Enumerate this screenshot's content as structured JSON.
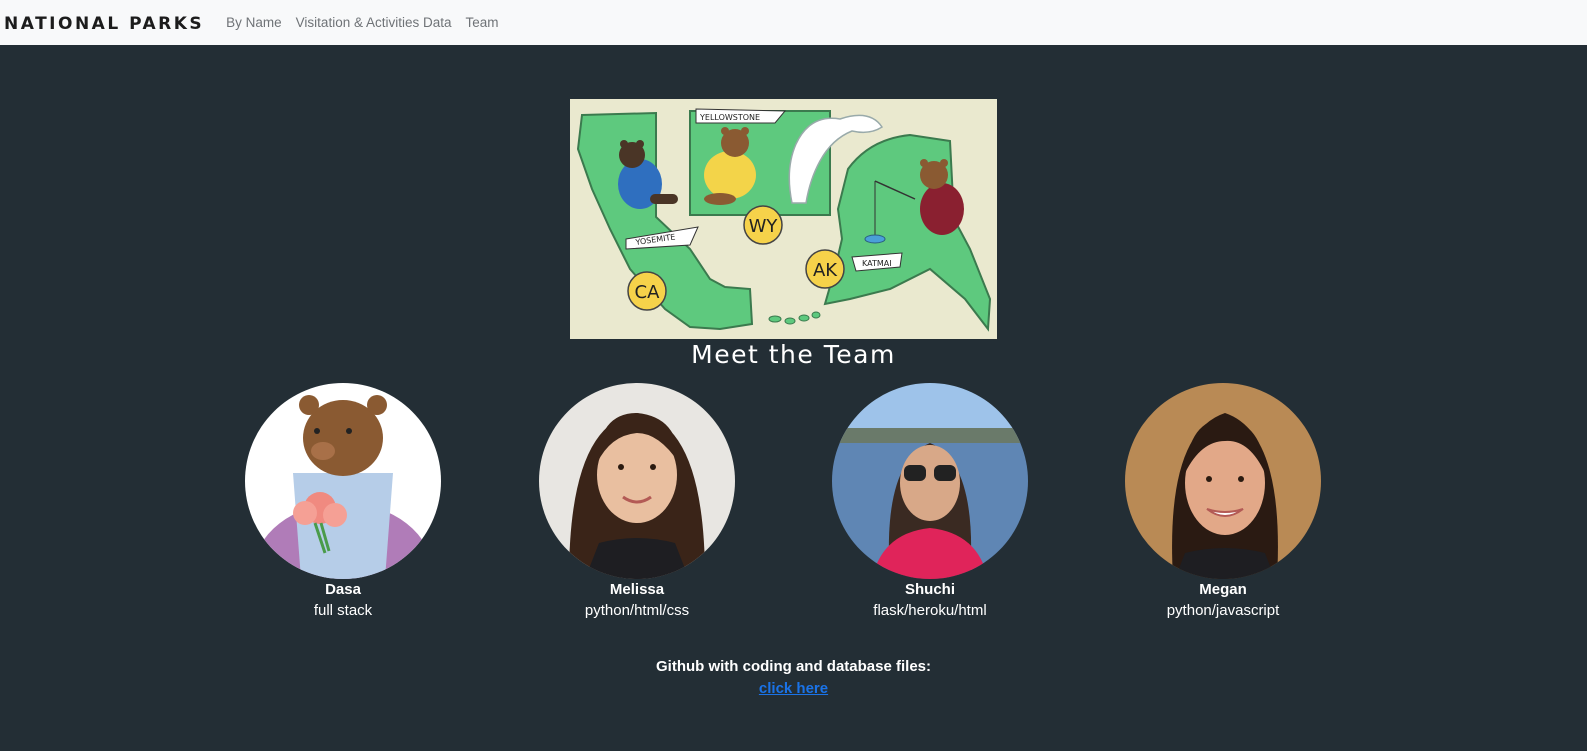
{
  "nav": {
    "brand": "NATIONAL PARKS",
    "links": [
      "By Name",
      "Visitation & Activities Data",
      "Team"
    ]
  },
  "hero": {
    "labels": {
      "yellowstone": "YELLOWSTONE",
      "yosemite": "YOSEMITE",
      "katmai": "KATMAI",
      "ca": "CA",
      "wy": "WY",
      "ak": "AK"
    }
  },
  "team": {
    "title": "Meet the Team",
    "members": [
      {
        "name": "Dasa",
        "role": "full stack"
      },
      {
        "name": "Melissa",
        "role": "python/html/css"
      },
      {
        "name": "Shuchi",
        "role": "flask/heroku/html"
      },
      {
        "name": "Megan",
        "role": "python/javascript"
      }
    ]
  },
  "github": {
    "label": "Github with coding and database files:",
    "link_text": "click here"
  },
  "colors": {
    "background": "#232e35",
    "navbar": "#f8f9fa",
    "link": "#1a73e8",
    "map_green": "#5ec97e",
    "badge_yellow": "#f6d24a"
  }
}
